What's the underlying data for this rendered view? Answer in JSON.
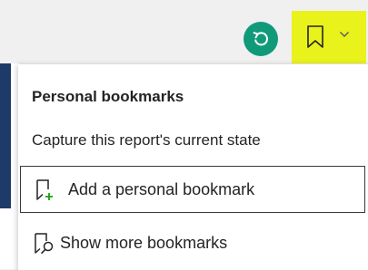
{
  "toolbar": {
    "reset_icon": "reset-icon",
    "bookmark_icon": "bookmark-icon",
    "chevron_icon": "chevron-down-icon",
    "reset_color": "#119a7a",
    "highlight_color": "#e9f21a"
  },
  "flyout": {
    "title": "Personal bookmarks",
    "subtitle": "Capture this report's current state",
    "items": [
      {
        "label": "Add a personal bookmark",
        "icon": "add-bookmark-icon",
        "icon_accent": "#13a10e"
      },
      {
        "label": "Show more bookmarks",
        "icon": "show-more-bookmarks-icon"
      }
    ]
  }
}
